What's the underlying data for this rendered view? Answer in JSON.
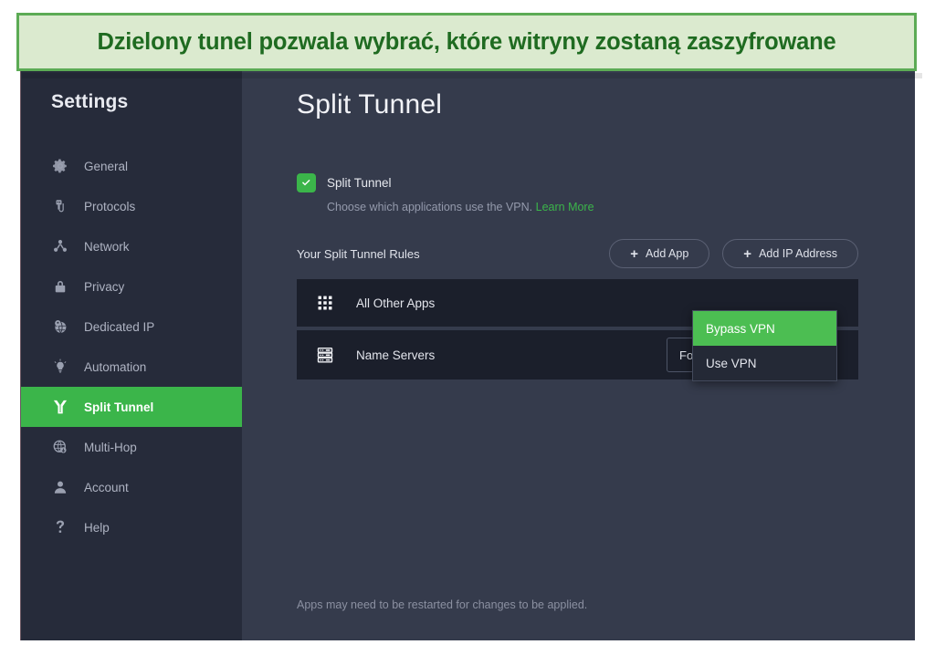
{
  "banner": {
    "text": "Dzielony tunel pozwala wybrać, które witryny zostaną zaszyfrowane",
    "bg_color": "#dbeacf",
    "border_color": "#5cab55",
    "text_color": "#1f6b21"
  },
  "colors": {
    "accent_green": "#3bb54a",
    "sidebar_bg": "#262b3a",
    "main_bg": "#353b4c",
    "row_bg": "#1b1f2b"
  },
  "sidebar": {
    "title": "Settings",
    "items": [
      {
        "label": "General",
        "icon": "gear-icon",
        "active": false
      },
      {
        "label": "Protocols",
        "icon": "usb-plug-icon",
        "active": false
      },
      {
        "label": "Network",
        "icon": "network-icon",
        "active": false
      },
      {
        "label": "Privacy",
        "icon": "lock-icon",
        "active": false
      },
      {
        "label": "Dedicated IP",
        "icon": "globe-pin-icon",
        "active": false
      },
      {
        "label": "Automation",
        "icon": "lightbulb-icon",
        "active": false
      },
      {
        "label": "Split Tunnel",
        "icon": "split-tunnel-icon",
        "active": true
      },
      {
        "label": "Multi-Hop",
        "icon": "multi-hop-icon",
        "active": false
      },
      {
        "label": "Account",
        "icon": "person-icon",
        "active": false
      },
      {
        "label": "Help",
        "icon": "question-mark-icon",
        "active": false
      }
    ]
  },
  "main": {
    "page_title": "Split Tunnel",
    "toggle": {
      "label": "Split Tunnel",
      "checked": true,
      "description": "Choose which applications use the VPN.",
      "link_label": "Learn More"
    },
    "rules": {
      "section_title": "Your Split Tunnel Rules",
      "buttons": [
        {
          "label": "Add App",
          "icon": "plus-icon"
        },
        {
          "label": "Add IP Address",
          "icon": "plus-icon"
        }
      ],
      "rows": [
        {
          "label": "All Other Apps",
          "icon": "grid-dots-icon",
          "select_value": "Bypass VPN",
          "select_open": true
        },
        {
          "label": "Name Servers",
          "icon": "server-rack-icon",
          "select_value": "Follow App Rules",
          "select_open": false
        }
      ]
    },
    "dropdown": {
      "options": [
        "Bypass VPN",
        "Use VPN"
      ],
      "selected": "Bypass VPN"
    },
    "footer_note": "Apps may need to be restarted for changes to be applied."
  }
}
